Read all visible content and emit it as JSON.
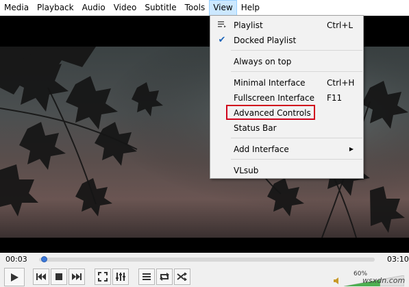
{
  "menubar": {
    "items": [
      {
        "label": "Media"
      },
      {
        "label": "Playback"
      },
      {
        "label": "Audio"
      },
      {
        "label": "Video"
      },
      {
        "label": "Subtitle"
      },
      {
        "label": "Tools"
      },
      {
        "label": "View",
        "active": true
      },
      {
        "label": "Help"
      }
    ]
  },
  "view_menu": {
    "items": [
      {
        "label": "Playlist",
        "shortcut": "Ctrl+L",
        "icon": "playlist-icon"
      },
      {
        "label": "Docked Playlist",
        "checked": true
      },
      {
        "label": "Always on top"
      },
      {
        "label": "Minimal Interface",
        "shortcut": "Ctrl+H"
      },
      {
        "label": "Fullscreen Interface",
        "shortcut": "F11"
      },
      {
        "label": "Advanced Controls",
        "highlighted": true
      },
      {
        "label": "Status Bar"
      },
      {
        "label": "Add Interface",
        "submenu": true
      },
      {
        "label": "VLsub"
      }
    ]
  },
  "seek": {
    "elapsed": "00:03",
    "total": "03:10",
    "progress": 0.016
  },
  "controls": {
    "buttons": [
      "play-icon",
      "previous-icon",
      "stop-icon",
      "next-icon",
      "fullscreen-icon",
      "extended-settings-icon",
      "playlist-toggle-icon",
      "loop-icon",
      "shuffle-icon"
    ],
    "volume_percent": "60%",
    "volume_level": 0.6
  },
  "watermark": "wsxdn.com",
  "colors": {
    "menu_highlight": "#cce8ff",
    "checkmark": "#1a63b8",
    "annotation": "#d0021b",
    "seek_knob": "#3c78d8",
    "volume_fill": "#4caf50"
  }
}
